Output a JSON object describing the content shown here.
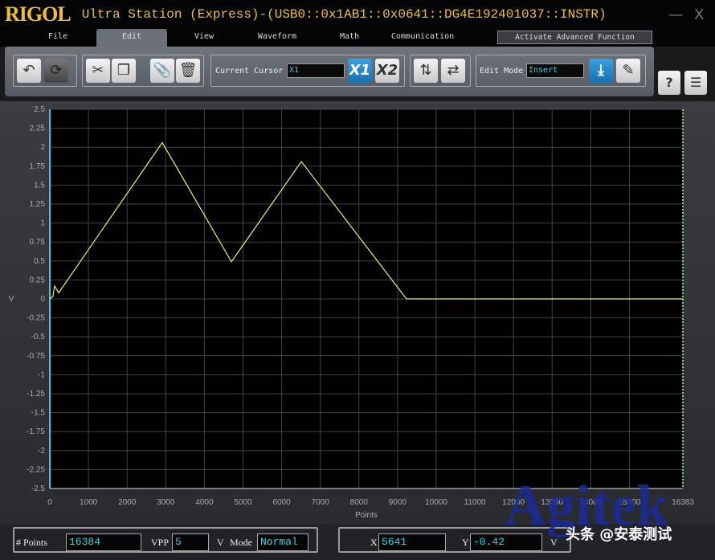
{
  "window": {
    "logo": "RIGOL",
    "title": "Ultra Station (Express)-(USB0::0x1AB1::0x0641::DG4E192401037::INSTR)",
    "minimize": "—",
    "close": "X"
  },
  "menu": [
    {
      "label": "File"
    },
    {
      "label": "Edit",
      "active": true
    },
    {
      "label": "View"
    },
    {
      "label": "Waveform"
    },
    {
      "label": "Math"
    },
    {
      "label": "Communication"
    }
  ],
  "activate_label": "Activate Advanced Function",
  "toolbar": {
    "current_cursor_label": "Current Cursor",
    "current_cursor_value": "X1",
    "x1": "X1",
    "x2": "X2",
    "edit_mode_label": "Edit Mode",
    "edit_mode_value": "Insert",
    "help": "?"
  },
  "chart_data": {
    "type": "line",
    "xlabel": "Points",
    "ylabel": "V",
    "xlim": [
      0,
      16383
    ],
    "ylim": [
      -2.5,
      2.5
    ],
    "grid": true,
    "x_ticks": [
      "0",
      "1000",
      "2000",
      "3000",
      "4000",
      "5000",
      "6000",
      "7000",
      "8000",
      "9000",
      "10000",
      "11000",
      "12000",
      "13000",
      "14000",
      "15000",
      "16383"
    ],
    "y_ticks": [
      "2.5",
      "2.25",
      "2",
      "1.75",
      "1.5",
      "1.25",
      "1",
      "0.75",
      "0.5",
      "0.25",
      "0",
      "-0.25",
      "-0.5",
      "-0.75",
      "-1",
      "-1.25",
      "-1.5",
      "-1.75",
      "-2",
      "-2.25",
      "-2.5"
    ],
    "line_color": "#f0f070",
    "series": [
      {
        "x": [
          0,
          80,
          125,
          229,
          2910,
          4700,
          6510,
          9230,
          16383
        ],
        "y": [
          0,
          0.03,
          0.17,
          0.08,
          2.06,
          0.49,
          1.81,
          0,
          0
        ]
      }
    ]
  },
  "status": {
    "points_label": "# Points",
    "points_value": "16384",
    "vpp_label": "VPP",
    "vpp_value": "5",
    "vpp_unit": "V",
    "mode_label": "Mode",
    "mode_value": "Normal",
    "x_label": "X",
    "x_value": "5641",
    "y_label": "Y",
    "y_value": "-0.42",
    "y_unit": "V"
  },
  "watermark": {
    "brand": "Agitek",
    "caption": "头条 @安泰测试"
  }
}
